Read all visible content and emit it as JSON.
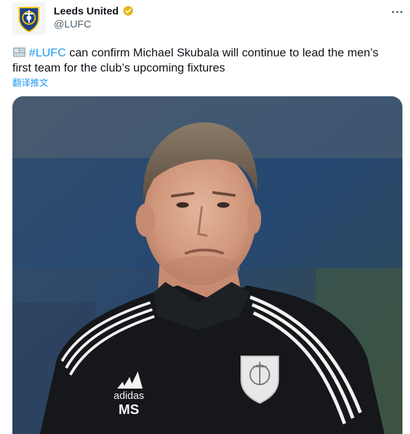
{
  "account": {
    "name": "Leeds United",
    "handle": "@LUFC",
    "avatar_icon": "leeds-crest-icon",
    "verified_icon": "verified-badge-icon"
  },
  "tweet": {
    "emoji_icon": "newspaper-emoji-icon",
    "hashtag": "#LUFC",
    "body": " can confirm Michael Skubala will continue to lead the men’s first team for the club’s upcoming fixtures",
    "translate_label": "翻译推文"
  },
  "media": {
    "description_icon": "photo-of-coach",
    "jacket_brand": "adidas",
    "jacket_initials": "MS"
  },
  "colors": {
    "link": "#1d9bf0",
    "secondary": "#536471",
    "verified_gold": "#e2b719"
  }
}
